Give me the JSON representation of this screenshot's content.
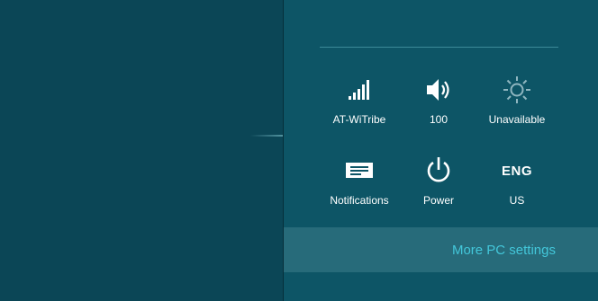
{
  "colors": {
    "left_background": "#0b4656",
    "pane_background": "#0d5566",
    "highlight_row": "#276b7a",
    "link_accent": "#43c7da",
    "icon_color": "#ffffff"
  },
  "quick_settings": [
    {
      "icon": "network-signal-icon",
      "label": "AT-WiTribe"
    },
    {
      "icon": "speaker-volume-icon",
      "label": "100"
    },
    {
      "icon": "brightness-sun-icon",
      "label": "Unavailable"
    },
    {
      "icon": "notifications-icon",
      "label": "Notifications"
    },
    {
      "icon": "power-icon",
      "label": "Power"
    },
    {
      "icon": "keyboard-language-icon",
      "glyph": "ENG",
      "label": "US"
    }
  ],
  "more_settings_label": "More PC settings"
}
